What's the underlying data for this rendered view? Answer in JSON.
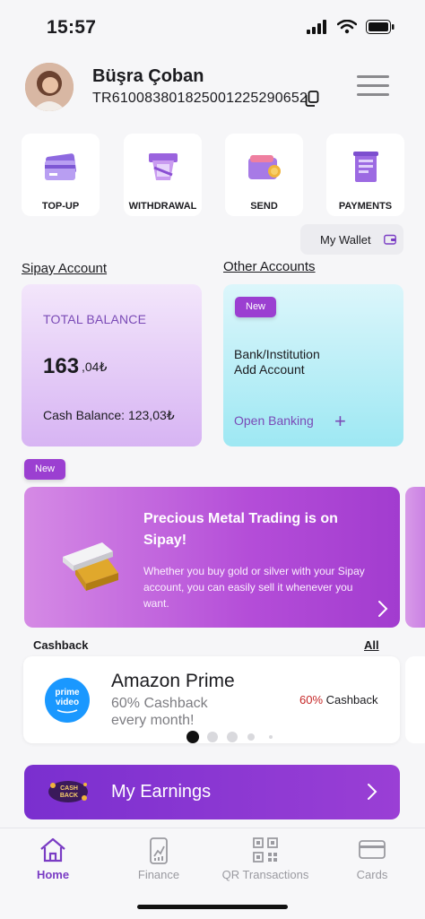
{
  "status": {
    "time": "15:57"
  },
  "profile": {
    "name": "Büşra Çoban",
    "iban": "TR610083801825001225290652"
  },
  "quick_actions": [
    {
      "label": "TOP-UP",
      "icon": "cards-icon"
    },
    {
      "label": "WITHDRAWAL",
      "icon": "cash-withdraw-icon"
    },
    {
      "label": "SEND",
      "icon": "wallet-send-icon"
    },
    {
      "label": "PAYMENTS",
      "icon": "invoice-icon"
    }
  ],
  "wallet": {
    "label": "My Wallet"
  },
  "sections": {
    "sipay_account": "Sipay Account",
    "other_accounts": "Other Accounts"
  },
  "balance": {
    "title": "TOTAL BALANCE",
    "amount_int": "163",
    "amount_frac": ",04₺",
    "cash": "Cash Balance: 123,03₺"
  },
  "other": {
    "badge": "New",
    "line1": "Bank/Institution",
    "line2": "Add Account",
    "open_banking": "Open Banking",
    "plus": "+"
  },
  "promo": {
    "badge": "New",
    "title": "Precious Metal Trading is on Sipay!",
    "text": "Whether you buy gold or silver with your Sipay account, you can easily sell it whenever you want."
  },
  "cashback": {
    "label": "Cashback",
    "all": "All",
    "logo_line1": "prime",
    "logo_line2": "video",
    "title": "Amazon Prime",
    "sub1": "60% Cashback",
    "sub2": "every month!",
    "right_pct": "60%",
    "right_text": " Cashback",
    "active_slide": 1,
    "slide_count": 5
  },
  "earnings": {
    "title": "My Earnings",
    "badge_text": "CASH BACK"
  },
  "tabs": [
    {
      "label": "Home",
      "icon": "home-icon",
      "active": true
    },
    {
      "label": "Finance",
      "icon": "finance-icon",
      "active": false
    },
    {
      "label": "QR Transactions",
      "icon": "qr-code-icon",
      "active": false
    },
    {
      "label": "Cards",
      "icon": "card-icon",
      "active": false
    }
  ],
  "colors": {
    "accent": "#7a3cc4",
    "badge": "#9b3fd1",
    "earnings": "#8a36d2",
    "cashback_pct": "#c62828"
  }
}
